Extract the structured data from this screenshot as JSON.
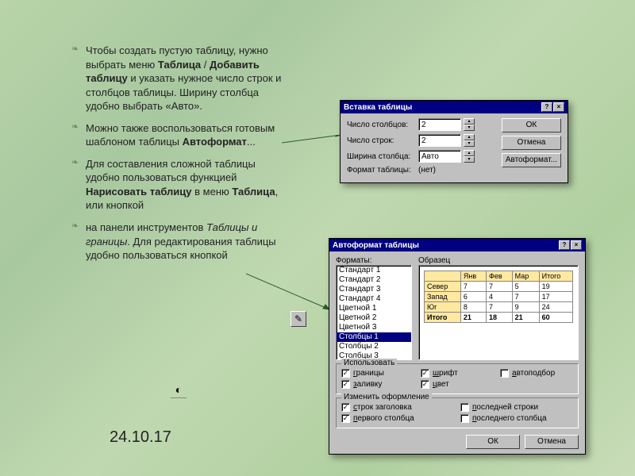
{
  "bullets": {
    "item1": "Чтобы создать пустую таблицу, нужно выбрать меню <b>Таблица</b> / <b>Добавить таблицу</b> и указать нужное число строк и столбцов таблицы. Ширину столбца удобно выбрать «Авто».",
    "item2": "Можно также воспользоваться готовым шаблоном таблицы <b>Автоформат</b>...",
    "item3": "Для составления сложной таблицы удобно пользоваться функцией <b>Нарисовать таблицу</b> в меню <b>Таблица</b>, или кнопкой",
    "item4": "на панели инструментов <i>Таблицы и границы</i>. Для редактирования таблицы удобно пользоваться кнопкой"
  },
  "date": "24.10.17",
  "dialog1": {
    "title": "Вставка таблицы",
    "cols_label": "Число столбцов:",
    "cols_value": "2",
    "rows_label": "Число строк:",
    "rows_value": "2",
    "width_label": "Ширина столбца:",
    "width_value": "Авто",
    "format_label": "Формат таблицы:",
    "format_value": "(нет)",
    "ok": "ОК",
    "cancel": "Отмена",
    "autoformat": "Автоформат..."
  },
  "dialog2": {
    "title": "Автоформат таблицы",
    "formats_label": "Форматы:",
    "sample_label": "Образец",
    "formats": [
      "Стандарт 1",
      "Стандарт 2",
      "Стандарт 3",
      "Стандарт 4",
      "Цветной 1",
      "Цветной 2",
      "Цветной 3",
      "Столбцы 1",
      "Столбцы 2",
      "Столбцы 3"
    ],
    "selected_index": 7,
    "preview": {
      "cols": [
        "",
        "Янв",
        "Фев",
        "Мар",
        "Итого"
      ],
      "rows": [
        [
          "Север",
          "7",
          "7",
          "5",
          "19"
        ],
        [
          "Запад",
          "6",
          "4",
          "7",
          "17"
        ],
        [
          "Юг",
          "8",
          "7",
          "9",
          "24"
        ],
        [
          "Итого",
          "21",
          "18",
          "21",
          "60"
        ]
      ]
    },
    "use_label": "Использовать",
    "checks1": [
      {
        "label": "границы",
        "checked": true
      },
      {
        "label": "шрифт",
        "checked": true
      },
      {
        "label": "автоподбор",
        "checked": false
      },
      {
        "label": "заливку",
        "checked": true
      },
      {
        "label": "цвет",
        "checked": true
      }
    ],
    "change_label": "Изменить оформление",
    "checks2": [
      {
        "label": "строк заголовка",
        "checked": true
      },
      {
        "label": "последней строки",
        "checked": false
      },
      {
        "label": "первого столбца",
        "checked": true
      },
      {
        "label": "последнего столбца",
        "checked": false
      }
    ],
    "ok": "ОК",
    "cancel": "Отмена"
  }
}
